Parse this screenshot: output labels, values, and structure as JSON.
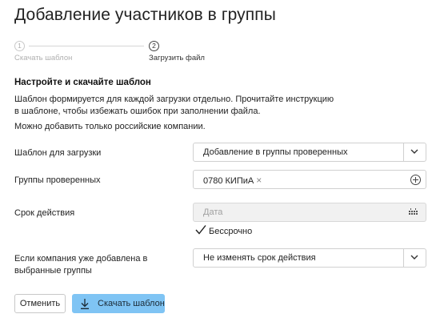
{
  "page": {
    "title": "Добавление участников в группы"
  },
  "stepper": {
    "steps": [
      {
        "number": "1",
        "label": "Скачать шаблон"
      },
      {
        "number": "2",
        "label": "Загрузить файл"
      }
    ]
  },
  "section": {
    "title": "Настройте и скачайте шаблон",
    "info_1": "Шаблон формируется для каждой загрузки отдельно. Прочитайте инструкцию в шаблоне, чтобы избежать ошибок при заполнении файла.",
    "info_2": "Можно добавить только российские компании."
  },
  "form": {
    "template": {
      "label": "Шаблон для загрузки",
      "value": "Добавление в группы проверенных"
    },
    "groups": {
      "label": "Группы проверенных",
      "tag": "0780 КИПиА",
      "tag_remove": "×"
    },
    "validity": {
      "label": "Срок действия",
      "placeholder": "Дата",
      "checkbox_label": "Бессрочно",
      "checkbox_checked": true
    },
    "existing": {
      "label": "Если компания уже добавлена в выбранные группы",
      "value": "Не изменять срок действия"
    }
  },
  "buttons": {
    "cancel": "Отменить",
    "download": "Скачать шаблон"
  },
  "colors": {
    "primary": "#7fc4f4",
    "border": "#d0d0d0",
    "disabled_bg": "#f1f1f1",
    "muted": "#b0b0b0"
  }
}
